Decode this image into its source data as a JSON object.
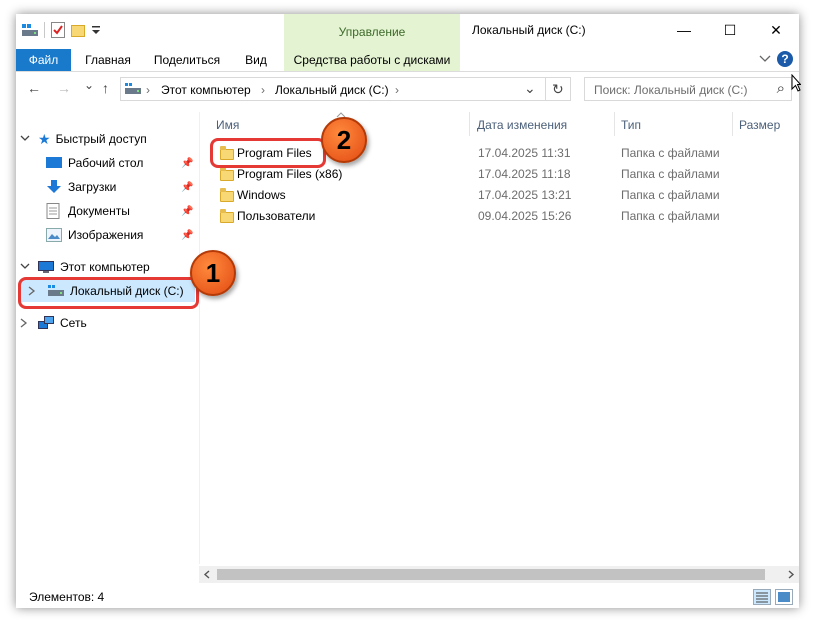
{
  "window": {
    "title": "Локальный диск (C:)",
    "context_tab_group": "Управление",
    "controls": {
      "minimize": "—",
      "maximize": "☐",
      "close": "✕"
    }
  },
  "ribbon": {
    "tabs": [
      {
        "label": "Файл"
      },
      {
        "label": "Главная"
      },
      {
        "label": "Поделиться"
      },
      {
        "label": "Вид"
      },
      {
        "label": "Средства работы с дисками"
      }
    ],
    "collapse_icon": "chevron-down-icon",
    "help": "?"
  },
  "navigation": {
    "back": "←",
    "forward": "→",
    "recent": "⌄",
    "up": "↑",
    "breadcrumbs": [
      "Этот компьютер",
      "Локальный диск (C:)"
    ],
    "separator": "›",
    "dropdown": "⌄",
    "refresh": "↻"
  },
  "search": {
    "placeholder": "Поиск: Локальный диск (C:)",
    "icon": "⌕"
  },
  "sidebar": {
    "quick_access": "Быстрый доступ",
    "items": [
      {
        "label": "Рабочий стол",
        "icon": "desktop-icon"
      },
      {
        "label": "Загрузки",
        "icon": "downloads-icon"
      },
      {
        "label": "Документы",
        "icon": "documents-icon"
      },
      {
        "label": "Изображения",
        "icon": "pictures-icon"
      }
    ],
    "this_pc": "Этот компьютер",
    "drive": "Локальный диск (C:)",
    "network": "Сеть"
  },
  "columns": {
    "name": "Имя",
    "date": "Дата изменения",
    "type": "Тип",
    "size": "Размер"
  },
  "files": [
    {
      "name": "Program Files",
      "date": "17.04.2025 11:31",
      "type": "Папка с файлами"
    },
    {
      "name": "Program Files (x86)",
      "date": "17.04.2025 11:18",
      "type": "Папка с файлами"
    },
    {
      "name": "Windows",
      "date": "17.04.2025 13:21",
      "type": "Папка с файлами"
    },
    {
      "name": "Пользователи",
      "date": "09.04.2025 15:26",
      "type": "Папка с файлами"
    }
  ],
  "annotations": {
    "badge1": "1",
    "badge2": "2"
  },
  "status": {
    "items_count": "Элементов: 4"
  },
  "colors": {
    "accent": "#1979ca",
    "context_tab": "#e4f3d2",
    "selection": "#cce8ff",
    "highlight": "#e53935",
    "badge": "#f26b21"
  }
}
